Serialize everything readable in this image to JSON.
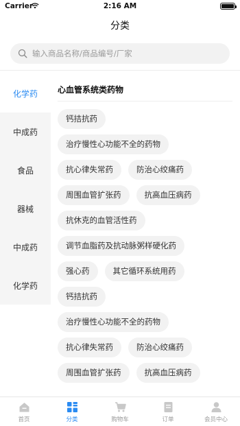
{
  "status_bar": {
    "carrier": "Carrier",
    "time": "2:16 AM"
  },
  "header": {
    "title": "分类"
  },
  "search": {
    "placeholder": "输入商品名称/商品编号/厂家"
  },
  "sidebar": {
    "items": [
      {
        "label": "化学药",
        "active": true
      },
      {
        "label": "中成药",
        "active": false
      },
      {
        "label": "食品",
        "active": false
      },
      {
        "label": "器械",
        "active": false
      },
      {
        "label": "中成药",
        "active": false
      },
      {
        "label": "化学药",
        "active": false
      }
    ]
  },
  "content": {
    "category_title": "心血管系统类药物",
    "tags": [
      "钙拮抗药",
      "治疗慢性心功能不全的药物",
      "抗心律失常药",
      "防治心绞痛药",
      "周围血管扩张药",
      "抗高血压病药",
      "抗休克的血管活性药",
      "调节血脂药及抗动脉粥样硬化药",
      "强心药",
      "其它循环系统用药",
      "钙拮抗药",
      "治疗慢性心功能不全的药物",
      "抗心律失常药",
      "防治心绞痛药",
      "周围血管扩张药",
      "抗高血压病药"
    ]
  },
  "tab_bar": {
    "tabs": [
      {
        "label": "首页",
        "icon": "home-icon",
        "active": false
      },
      {
        "label": "分类",
        "icon": "category-icon",
        "active": true
      },
      {
        "label": "购物车",
        "icon": "cart-icon",
        "active": false
      },
      {
        "label": "订单",
        "icon": "order-icon",
        "active": false
      },
      {
        "label": "会员中心",
        "icon": "user-icon",
        "active": false
      }
    ]
  },
  "colors": {
    "accent": "#2a8bf2",
    "tag_bg": "#f2f2f2",
    "sidebar_bg": "#f5f5f5",
    "inactive_icon": "#c8c8c8"
  }
}
